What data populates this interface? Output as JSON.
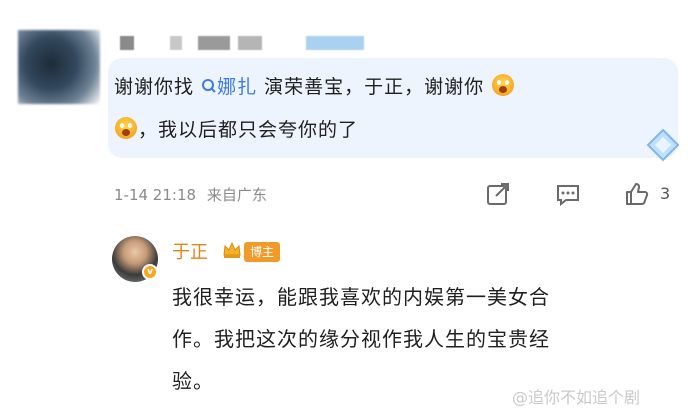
{
  "comment": {
    "line1_text_a": "谢谢你找",
    "mention_icon": "search-icon",
    "mention": "娜扎",
    "line1_text_b": " 演荣善宝，于正，谢谢你",
    "line2_text": "，我以后都只会夸你的了",
    "emoji": "scream-emoji",
    "timestamp": "1-14 21:18",
    "source": "来自广东",
    "like_count": "3",
    "highlight_color": "#3c7be0",
    "bubble_color": "#eef4fd"
  },
  "reply": {
    "author": "于正",
    "badge": "博主",
    "verified_icon": "v-badge-icon",
    "text_lines": [
      "我很幸运，能跟我喜欢的内娱第一美女合",
      "作。我把这次的缘分视作我人生的宝贵经",
      "验。"
    ],
    "name_color": "#e4831a"
  },
  "watermark": "@追你不如追个剧"
}
